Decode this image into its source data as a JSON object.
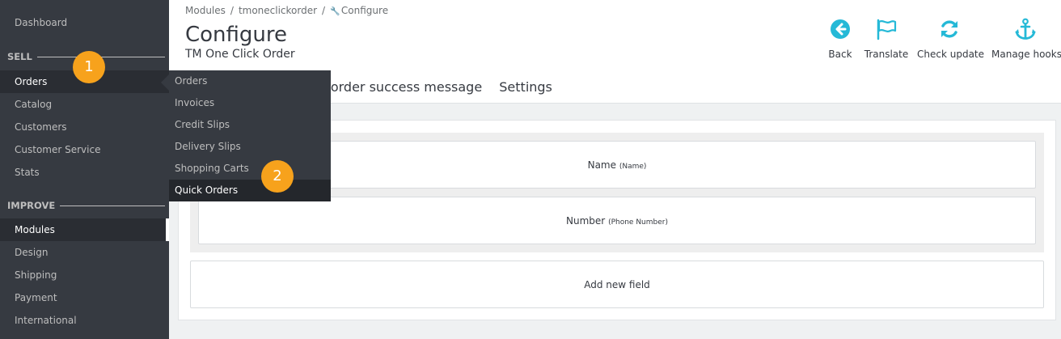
{
  "sidebar": {
    "dashboard": "Dashboard",
    "section_sell": "SELL",
    "sell_items": [
      "Orders",
      "Catalog",
      "Customers",
      "Customer Service",
      "Stats"
    ],
    "section_improve": "IMPROVE",
    "improve_items": [
      "Modules",
      "Design",
      "Shipping",
      "Payment",
      "International"
    ]
  },
  "submenu": {
    "items": [
      "Orders",
      "Invoices",
      "Credit Slips",
      "Delivery Slips",
      "Shopping Carts",
      "Quick Orders"
    ]
  },
  "badges": {
    "one": "1",
    "two": "2"
  },
  "breadcrumb": {
    "item1": "Modules",
    "sep": "/",
    "item2": "tmoneclickorder",
    "item3": "Configure"
  },
  "header": {
    "title": "Configure",
    "subtitle": "TM One Click Order"
  },
  "toolbar": {
    "back": "Back",
    "translate": "Translate",
    "check_update": "Check update",
    "manage_hooks": "Manage hooks"
  },
  "tabs": [
    "eorder success message",
    "Settings"
  ],
  "fields": [
    {
      "label": "Name",
      "hint": "(Name)"
    },
    {
      "label": "Number",
      "hint": "(Phone Number)"
    }
  ],
  "add_field_label": "Add new field",
  "colors": {
    "accent": "#25b9d7",
    "badge": "#f7a21c",
    "sidebar": "#363a41"
  }
}
